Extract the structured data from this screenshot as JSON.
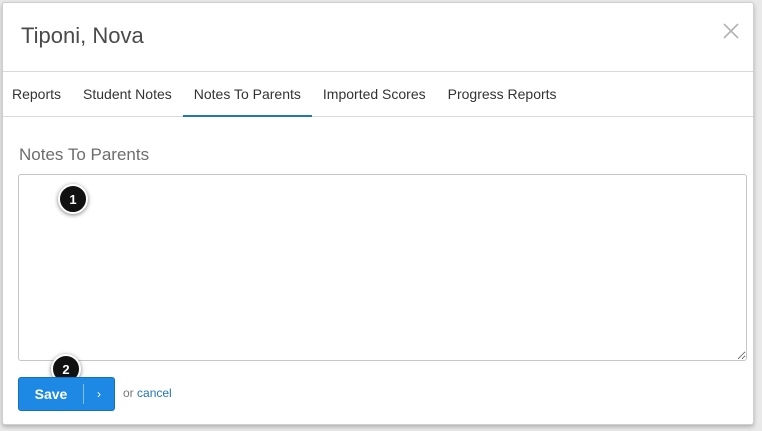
{
  "modal": {
    "title": "Tiponi, Nova",
    "close_icon": "close-x-icon"
  },
  "tabs": [
    {
      "label": "Reports",
      "active": false
    },
    {
      "label": "Student Notes",
      "active": false
    },
    {
      "label": "Notes To Parents",
      "active": true
    },
    {
      "label": "Imported Scores",
      "active": false
    },
    {
      "label": "Progress Reports",
      "active": false
    }
  ],
  "section": {
    "title": "Notes To Parents",
    "notes_value": ""
  },
  "callouts": {
    "first": "1",
    "second": "2"
  },
  "actions": {
    "save_label": "Save",
    "save_chevron_icon": "chevron-right-icon",
    "or_text": "or",
    "cancel_label": "cancel"
  },
  "colors": {
    "accent": "#1e88e5",
    "active_tab_underline": "#2277b8",
    "link": "#2277b8"
  }
}
